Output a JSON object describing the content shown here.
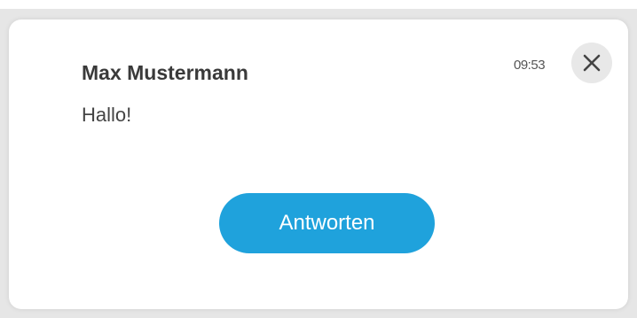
{
  "notification": {
    "sender": "Max Mustermann",
    "message": "Hallo!",
    "time": "09:53",
    "reply_label": "Antworten",
    "close_icon": "close-icon"
  },
  "colors": {
    "accent": "#1fa2dc",
    "card_background": "#ffffff",
    "page_background": "#e6e6e6",
    "close_button_background": "#e8e8e8",
    "text_primary": "#3a3a3a"
  }
}
